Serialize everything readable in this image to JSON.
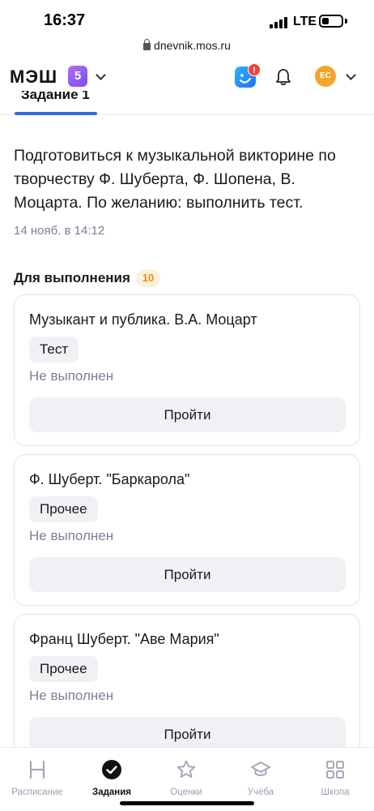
{
  "status_bar": {
    "time": "16:37",
    "network": "LTE"
  },
  "browser": {
    "url": "dnevnik.mos.ru",
    "lock_icon": "lock-icon"
  },
  "header": {
    "logo": "МЭШ",
    "grade": "5",
    "avatar_initials": "ЕС",
    "notification_count": "!",
    "icons": [
      "chevron-down-icon",
      "app-icon",
      "bell-icon"
    ],
    "accent_color": "#2d6be4"
  },
  "tab": {
    "label": "Задание 1"
  },
  "assignment": {
    "description": "Подготовиться к музыкальной викторине по творчеству Ф. Шуберта, Ф. Шопена, В. Моцарта. По желанию: выполнить тест.",
    "timestamp": "14 нояб. в 14:12"
  },
  "section": {
    "title": "Для выполнения",
    "count": "10"
  },
  "tasks": [
    {
      "title": "Музыкант и публика. В.А. Моцарт",
      "type": "Тест",
      "status": "Не выполнен",
      "action": "Пройти"
    },
    {
      "title": "Ф. Шуберт. \"Баркарола\"",
      "type": "Прочее",
      "status": "Не выполнен",
      "action": "Пройти"
    },
    {
      "title": "Франц Шуберт. \"Аве Мария\"",
      "type": "Прочее",
      "status": "Не выполнен",
      "action": "Пройти"
    }
  ],
  "bottom_nav": {
    "items": [
      {
        "label": "Расписание",
        "icon": "schedule-icon",
        "active": false
      },
      {
        "label": "Задания",
        "icon": "check-circle-icon",
        "active": true
      },
      {
        "label": "Оценки",
        "icon": "star-icon",
        "active": false
      },
      {
        "label": "Учёба",
        "icon": "graduation-cap-icon",
        "active": false
      },
      {
        "label": "Школа",
        "icon": "grid-icon",
        "active": false
      }
    ]
  }
}
